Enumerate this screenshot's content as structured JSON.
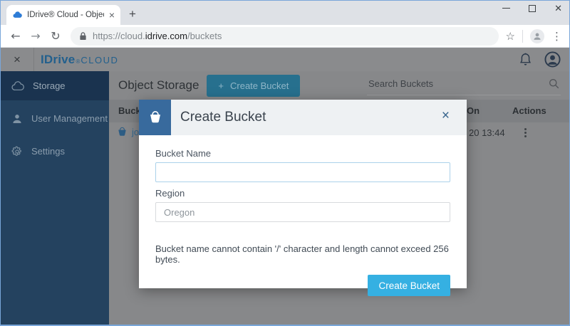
{
  "browser": {
    "tab_title": "IDrive® Cloud - Object Storage",
    "tab_close": "×",
    "new_tab": "+",
    "back": "←",
    "forward": "→",
    "reload": "↻",
    "url_scheme": "https://cloud.",
    "url_domain": "idrive.com",
    "url_path": "/buckets",
    "bookmark_star": "☆",
    "menu_kebab": "⋮",
    "window_close": "✕"
  },
  "app_header": {
    "menu_toggle": "×",
    "logo_brand": "IDrive",
    "logo_reg": "®",
    "logo_cloud": "CLOUD"
  },
  "sidebar": {
    "items": [
      {
        "label": "Storage",
        "icon": "cloud-storage-icon",
        "active": true
      },
      {
        "label": "User Management",
        "icon": "user-icon",
        "active": false
      },
      {
        "label": "Settings",
        "icon": "gear-icon",
        "active": false
      }
    ]
  },
  "main": {
    "title": "Object Storage",
    "create_button": {
      "plus": "+",
      "label": "Create Bucket"
    },
    "search_placeholder": "Search Buckets",
    "table": {
      "headers": {
        "name": "Bucket Name",
        "created": "Created On",
        "actions": "Actions"
      },
      "row": {
        "name_fragment": "jo",
        "created_fragment": "20 13:44"
      }
    }
  },
  "modal": {
    "title": "Create Bucket",
    "close": "×",
    "bucket_name_label": "Bucket Name",
    "bucket_name_value": "",
    "region_label": "Region",
    "region_value": "Oregon",
    "note": "Bucket name cannot contain '/' character and length cannot exceed 256 bytes.",
    "submit_label": "Create Bucket"
  },
  "colors": {
    "accent_blue": "#35b0e2",
    "sidebar_navy": "#24425f",
    "modal_icon_blue": "#386a9d",
    "logo_blue": "#23608d",
    "overlay_gray": "#87888a"
  }
}
